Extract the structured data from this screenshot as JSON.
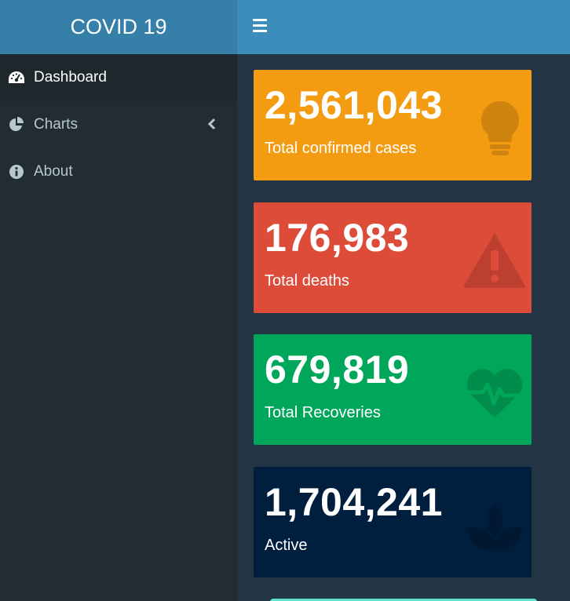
{
  "app": {
    "title": "COVID 19"
  },
  "sidebar": {
    "items": [
      {
        "label": "Dashboard",
        "icon": "dashboard-icon",
        "active": true
      },
      {
        "label": "Charts",
        "icon": "pie-chart-icon",
        "active": false
      },
      {
        "label": "About",
        "icon": "info-icon",
        "active": false
      }
    ]
  },
  "stats": [
    {
      "value": "2,561,043",
      "label": "Total confirmed cases",
      "color": "#f39c12",
      "icon": "lightbulb-icon"
    },
    {
      "value": "176,983",
      "label": "Total deaths",
      "color": "#dd4b39",
      "icon": "warning-icon"
    },
    {
      "value": "679,819",
      "label": "Total Recoveries",
      "color": "#00a65a",
      "icon": "heartbeat-icon"
    },
    {
      "value": "1,704,241",
      "label": "Active",
      "color": "#001f3f",
      "icon": "lotus-icon"
    }
  ],
  "colors": {
    "header": "#3c8dbc",
    "logo": "#367fa9",
    "sidebar": "#222d32",
    "content": "#233545"
  }
}
